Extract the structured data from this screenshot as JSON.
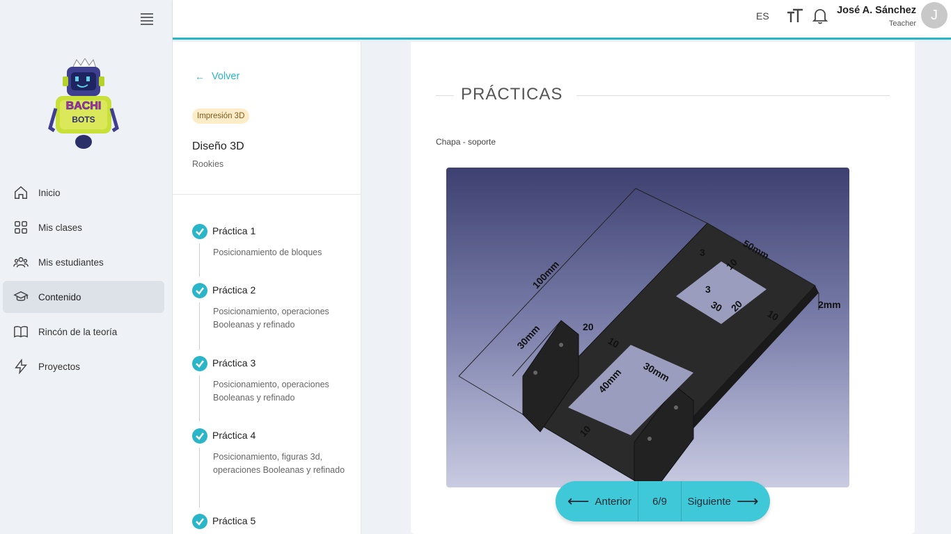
{
  "sidebar": {
    "logo_text_top": "BACHI",
    "logo_text_bottom": "BOTS",
    "items": [
      {
        "label": "Inicio",
        "icon": "home-icon"
      },
      {
        "label": "Mis clases",
        "icon": "grid-icon"
      },
      {
        "label": "Mis estudiantes",
        "icon": "users-icon"
      },
      {
        "label": "Contenido",
        "icon": "graduation-cap-icon",
        "active": true
      },
      {
        "label": "Rincón de la teoría",
        "icon": "book-icon"
      },
      {
        "label": "Proyectos",
        "icon": "lightning-icon"
      }
    ]
  },
  "topbar": {
    "language": "ES",
    "user_name": "José A. Sánchez",
    "user_role": "Teacher",
    "avatar_initial": "J",
    "accent_color": "#2bb5c8"
  },
  "course": {
    "back_label": "Volver",
    "tag": "Impresión 3D",
    "title": "Diseño 3D",
    "level": "Rookies",
    "practices": [
      {
        "title": "Práctica 1",
        "desc": "Posicionamiento de bloques"
      },
      {
        "title": "Práctica 2",
        "desc": "Posicionamiento, operaciones Booleanas y refinado"
      },
      {
        "title": "Práctica 3",
        "desc": "Posicionamiento, operaciones Booleanas y refinado"
      },
      {
        "title": "Práctica 4",
        "desc": "Posicionamiento, figuras 3d, operaciones Booleanas y refinado"
      },
      {
        "title": "Práctica 5",
        "desc": ""
      }
    ]
  },
  "main": {
    "section_title": "PRÁCTICAS",
    "subtitle": "Chapa - soporte",
    "figure_labels": {
      "d100": "100mm",
      "d50": "50mm",
      "d3a": "3",
      "d10a": "10",
      "d3b": "3",
      "d30a": "30",
      "d20a": "20",
      "d2": "2mm",
      "d10b": "10",
      "d20b": "20",
      "d30mm": "30mm",
      "d10c": "10",
      "d30mmb": "30mm",
      "d40mm": "40mm",
      "d10d": "10"
    }
  },
  "pager": {
    "prev_label": "Anterior",
    "count": "6/9",
    "next_label": "Siguiente"
  }
}
